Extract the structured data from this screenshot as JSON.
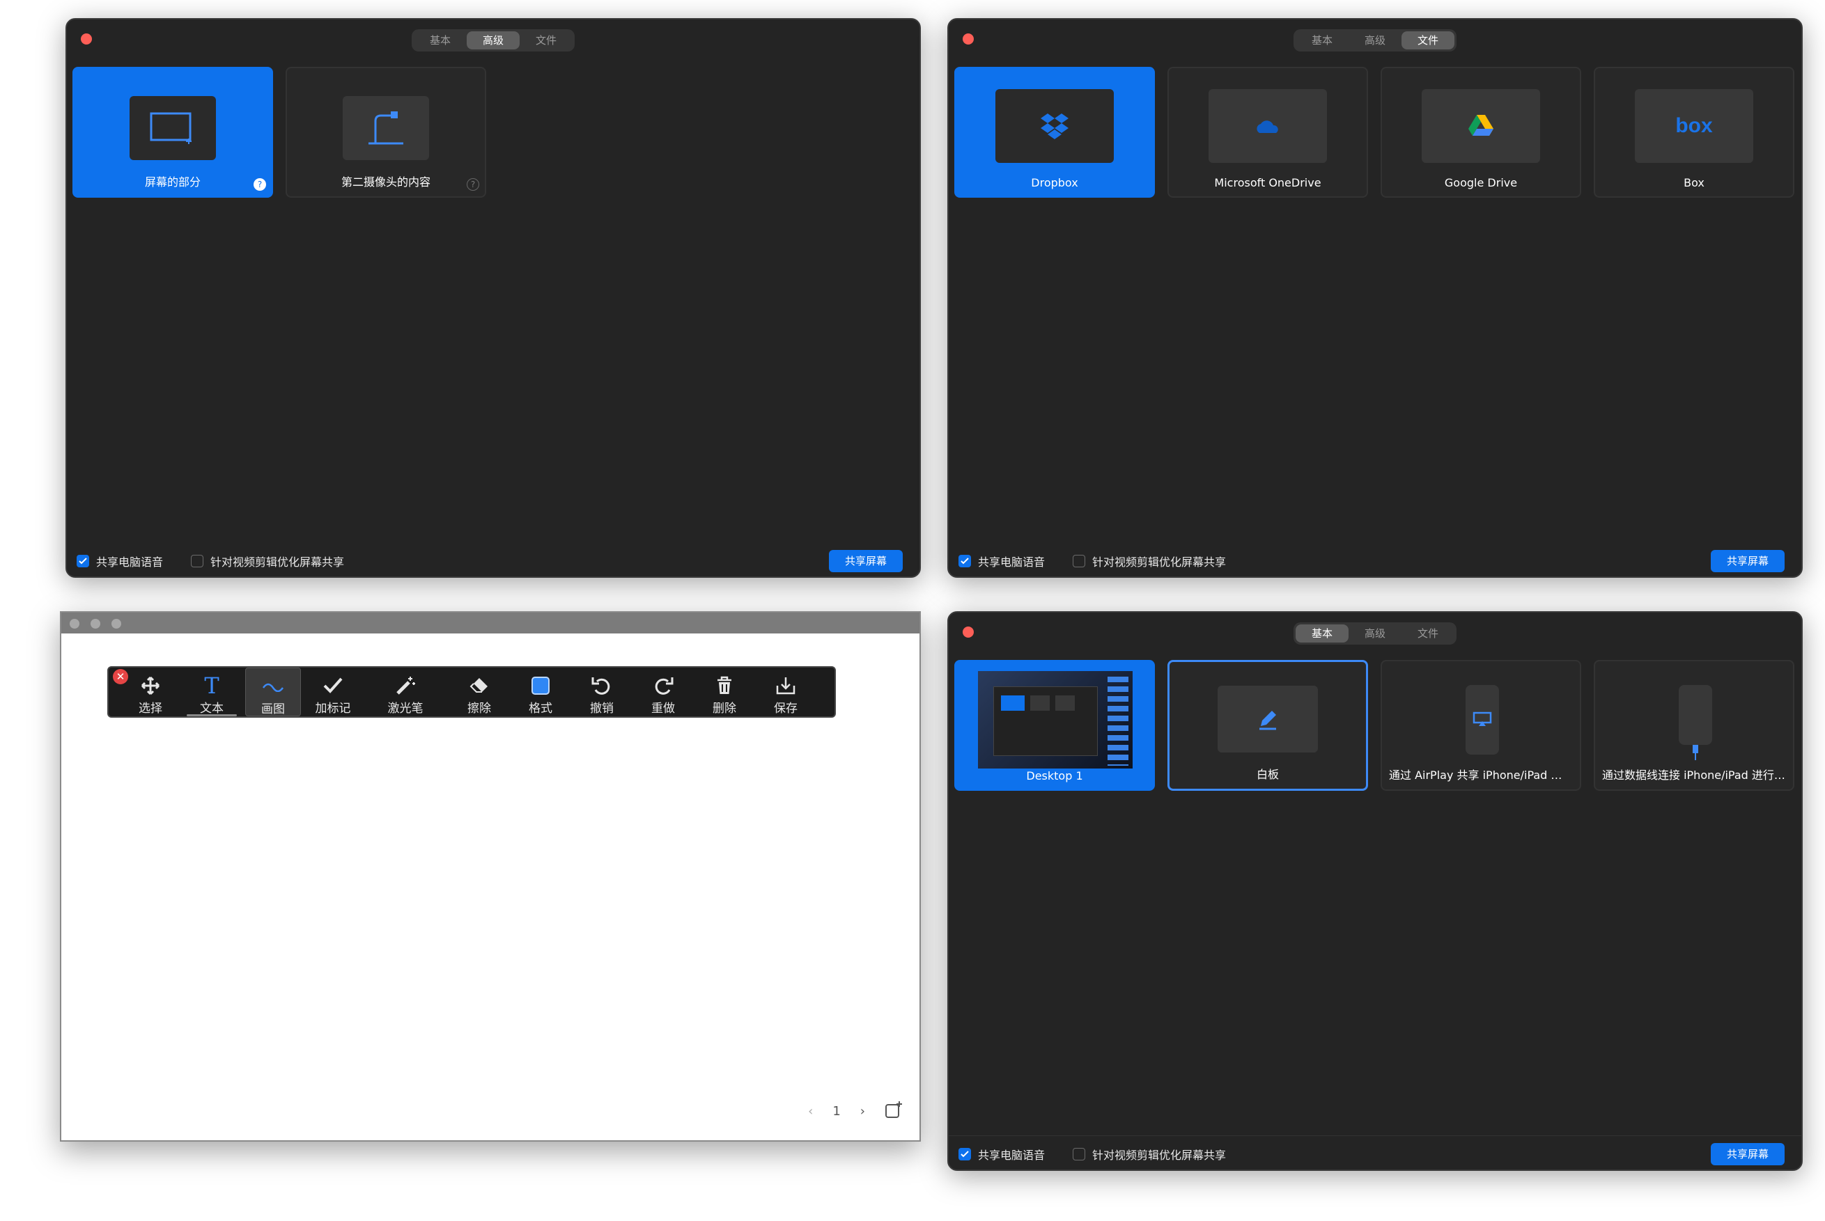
{
  "tabs": {
    "basic": "基本",
    "advanced": "高级",
    "files": "文件"
  },
  "options": {
    "share_audio": "共享电脑语音",
    "optimize_video": "针对视频剪辑优化屏幕共享",
    "share_button": "共享屏幕"
  },
  "advanced_window": {
    "active_tab": "advanced",
    "cards": [
      {
        "label": "屏幕的部分",
        "icon": "screen-portion-icon",
        "help": "?"
      },
      {
        "label": "第二摄像头的内容",
        "icon": "document-camera-icon",
        "help": "?"
      }
    ]
  },
  "files_window": {
    "active_tab": "files",
    "cards": [
      {
        "label": "Dropbox",
        "icon": "dropbox-icon"
      },
      {
        "label": "Microsoft OneDrive",
        "icon": "onedrive-icon"
      },
      {
        "label": "Google Drive",
        "icon": "google-drive-icon"
      },
      {
        "label": "Box",
        "icon": "box-icon",
        "logo_text": "box"
      }
    ]
  },
  "basic_window": {
    "active_tab": "basic",
    "cards": [
      {
        "label": "Desktop 1",
        "icon": "desktop-thumbnail"
      },
      {
        "label": "白板",
        "icon": "pen-icon"
      },
      {
        "label": "通过 AirPlay 共享 iPhone/iPad 屏幕",
        "icon": "airplay-phone-icon"
      },
      {
        "label": "通过数据线连接 iPhone/iPad 进行屏...",
        "icon": "cable-phone-icon"
      }
    ]
  },
  "whiteboard": {
    "tools": [
      {
        "label": "选择",
        "icon": "move-icon"
      },
      {
        "label": "文本",
        "icon": "text-icon"
      },
      {
        "label": "画图",
        "icon": "draw-icon"
      },
      {
        "label": "加标记",
        "icon": "checkmark-icon"
      },
      {
        "label": "激光笔",
        "icon": "laser-wand-icon"
      },
      {
        "label": "擦除",
        "icon": "eraser-icon"
      },
      {
        "label": "格式",
        "icon": "format-icon"
      },
      {
        "label": "撤销",
        "icon": "undo-icon"
      },
      {
        "label": "重做",
        "icon": "redo-icon"
      },
      {
        "label": "删除",
        "icon": "trash-icon"
      },
      {
        "label": "保存",
        "icon": "save-icon"
      }
    ],
    "page_number": "1",
    "close_symbol": "✕",
    "text_tool_glyph": "T"
  },
  "colors": {
    "accent": "#0e72ed",
    "window_bg": "#242424",
    "card_bg": "#282828"
  }
}
